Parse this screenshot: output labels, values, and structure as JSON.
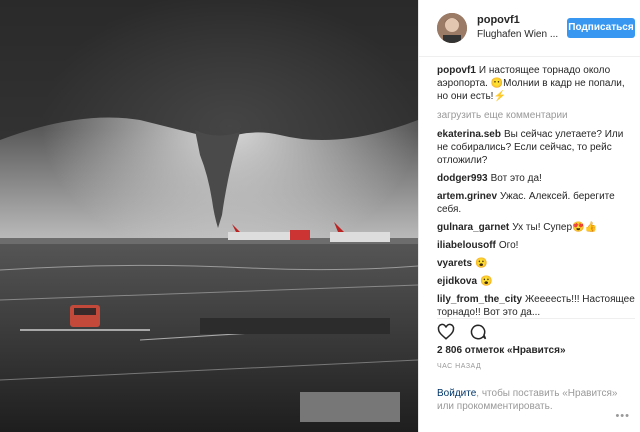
{
  "post": {
    "username": "popovf1",
    "location": "Flughafen Wien ...",
    "follow_label": "Подписаться",
    "caption_user": "popovf1",
    "caption_text": "И настоящее торнадо около аэропорта. 😶Молнии в кадр не попали, но они есть!⚡",
    "load_more": "загрузить еще комментарии",
    "comments": [
      {
        "user": "ekaterina.seb",
        "text": "Вы сейчас улетаете? Или не собирались? Если сейчас, то рейс отложили?"
      },
      {
        "user": "dodger993",
        "text": "Вот это да!"
      },
      {
        "user": "artem.grinev",
        "text": "Ужас. Алексей. берегите себя."
      },
      {
        "user": "gulnara_garnet",
        "text": "Ух ты! Супер😍👍"
      },
      {
        "user": "iliabelousoff",
        "text": "Ого!"
      },
      {
        "user": "vyarets",
        "text": "😮"
      },
      {
        "user": "ejidkova",
        "text": "😮"
      },
      {
        "user": "lily_from_the_city",
        "text": "Жеееесть!!! Настоящее торнадо!! Вот это да..."
      }
    ],
    "likes": "2 806 отметок «Нравится»",
    "time": "ЧАС НАЗАД",
    "login_link": "Войдите",
    "login_text": ", чтобы поставить «Нравится» или прокомментировать.",
    "more_icon": "ellipsis-icon",
    "like_icon": "heart-icon",
    "comment_icon": "comment-icon"
  }
}
